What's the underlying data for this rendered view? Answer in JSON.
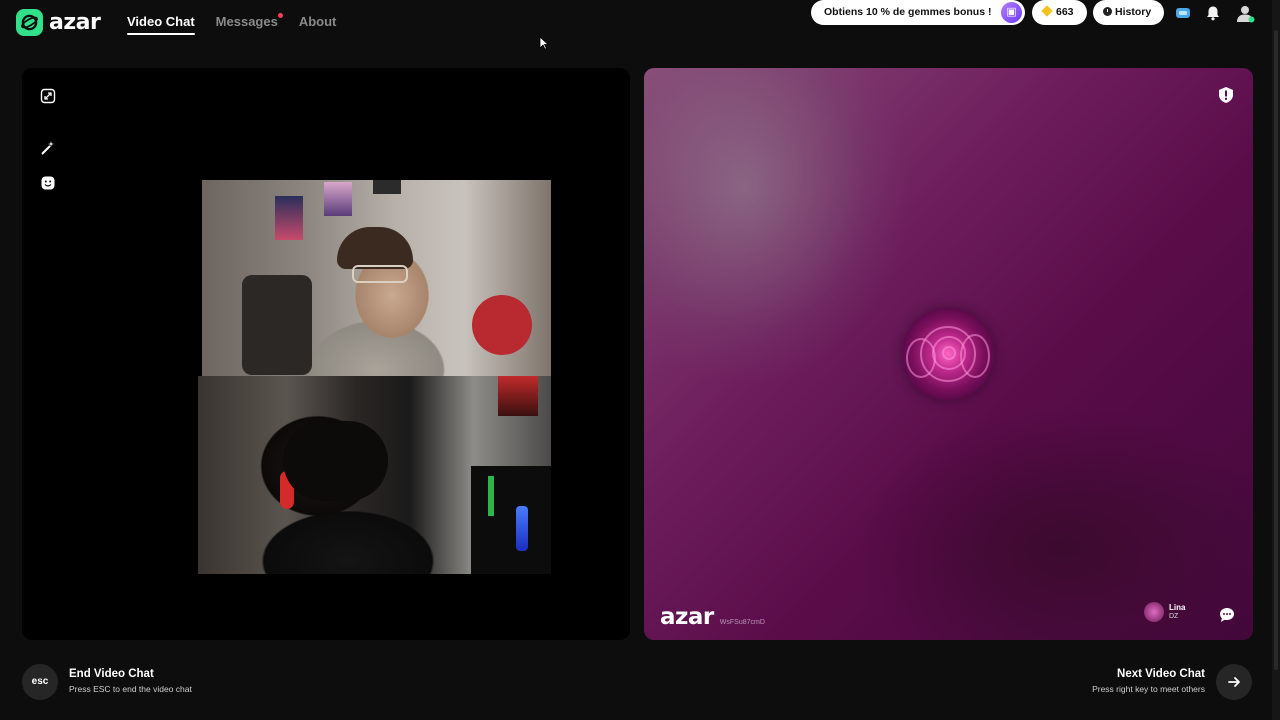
{
  "app": {
    "name": "azar"
  },
  "nav": {
    "items": [
      {
        "label": "Video Chat",
        "active": true
      },
      {
        "label": "Messages",
        "has_notification": true
      },
      {
        "label": "About"
      }
    ]
  },
  "header": {
    "promo_label": "Obtiens 10 % de gemmes bonus !",
    "gems_count": "663",
    "history_label": "History"
  },
  "remote": {
    "watermark_logo": "azar",
    "watermark_id": "WsFSu87cmD",
    "partner_name": "Lina",
    "partner_country": "DZ"
  },
  "footer": {
    "esc_label": "esc",
    "end_title": "End Video Chat",
    "end_subtitle": "Press ESC to end the video chat",
    "next_title": "Next Video Chat",
    "next_subtitle": "Press right key to meet others"
  },
  "colors": {
    "brand_green": "#33e08a",
    "background": "#0d0d0d",
    "remote_bg": "#5a0c49",
    "notification_dot": "#ff3b5c"
  }
}
